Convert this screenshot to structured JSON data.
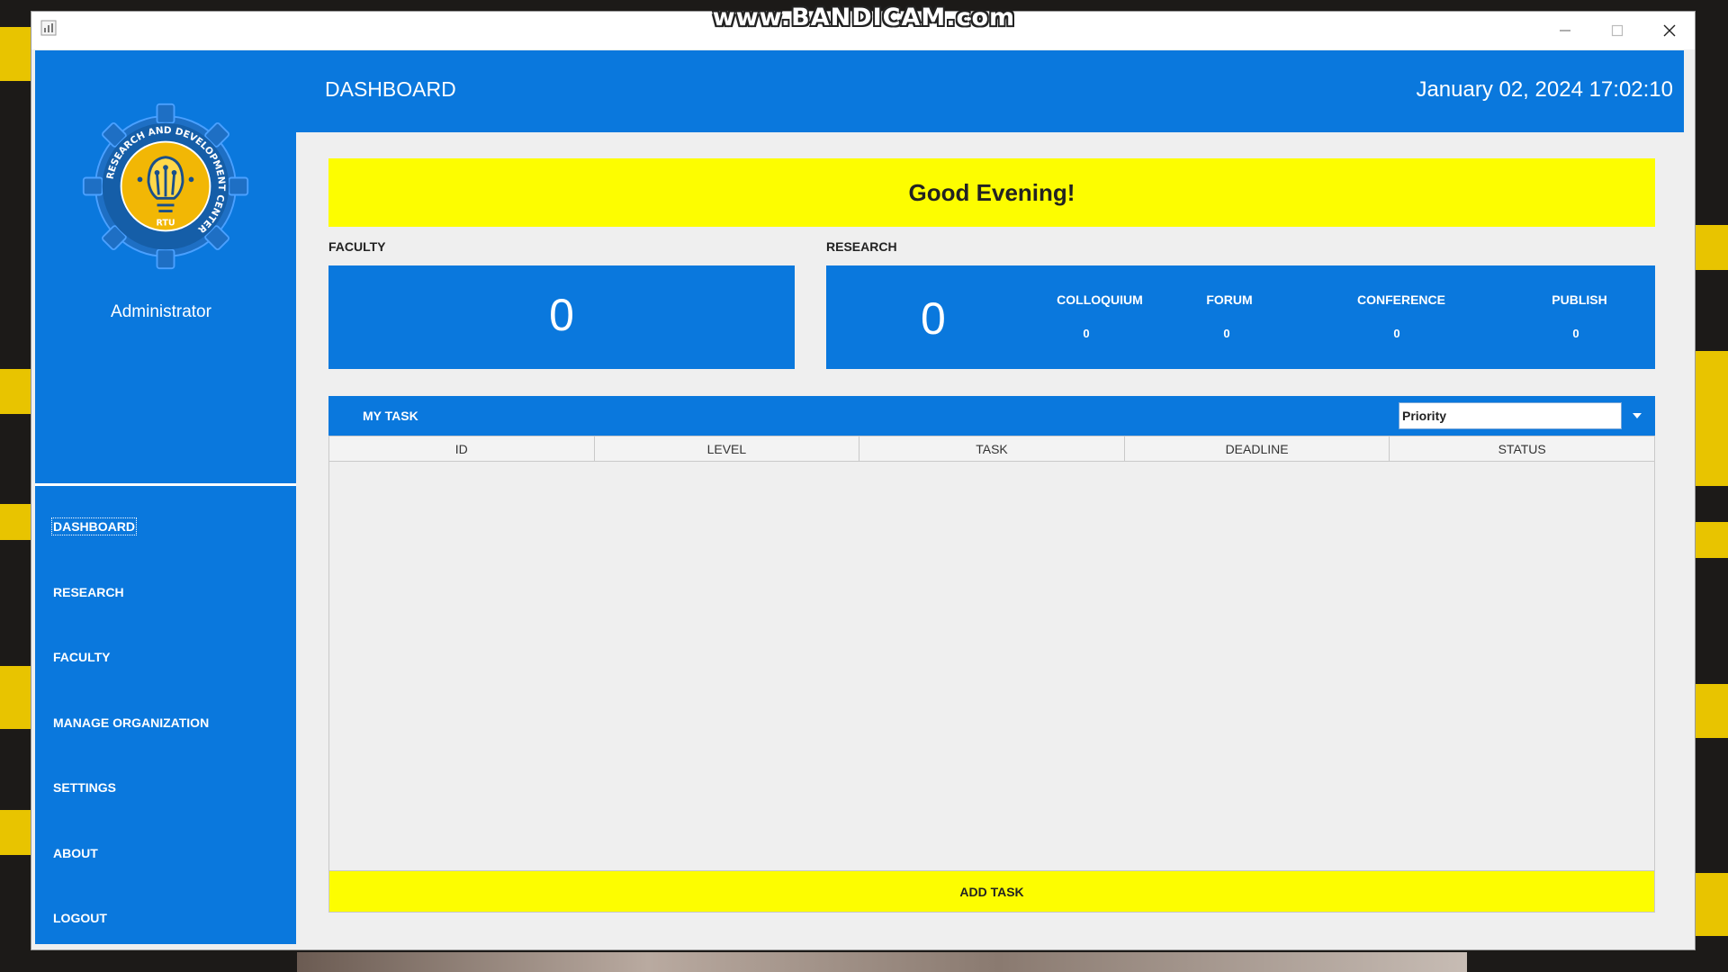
{
  "watermark": "www.BANDICAM.com",
  "window": {
    "min_icon": "minimize-icon",
    "max_icon": "maximize-icon",
    "close_icon": "close-icon"
  },
  "sidebar": {
    "role": "Administrator",
    "logo": {
      "ring_text": "RESEARCH AND DEVELOPMENT CENTER",
      "inner_text": "RTU"
    },
    "items": [
      {
        "label": "DASHBOARD",
        "active": true
      },
      {
        "label": "RESEARCH",
        "active": false
      },
      {
        "label": "FACULTY",
        "active": false
      },
      {
        "label": "MANAGE ORGANIZATION",
        "active": false
      },
      {
        "label": "SETTINGS",
        "active": false
      },
      {
        "label": "ABOUT",
        "active": false
      },
      {
        "label": "LOGOUT",
        "active": false
      }
    ]
  },
  "header": {
    "title": "DASHBOARD",
    "datetime": "January 02, 2024 17:02:10"
  },
  "greeting": "Good Evening!",
  "faculty": {
    "label": "FACULTY",
    "count": "0"
  },
  "research": {
    "label": "RESEARCH",
    "count": "0",
    "breakdown": [
      {
        "label": "COLLOQUIUM",
        "value": "0"
      },
      {
        "label": "FORUM",
        "value": "0"
      },
      {
        "label": "CONFERENCE",
        "value": "0"
      },
      {
        "label": "PUBLISH",
        "value": "0"
      }
    ]
  },
  "tasks": {
    "title": "MY TASK",
    "filter_selected": "Priority",
    "columns": [
      "ID",
      "LEVEL",
      "TASK",
      "DEADLINE",
      "STATUS"
    ],
    "rows": [],
    "add_label": "ADD TASK"
  },
  "colors": {
    "primary_blue": "#0a78dd",
    "accent_yellow": "#fdfd00",
    "logo_gold": "#f2b705",
    "background": "#efefef"
  }
}
